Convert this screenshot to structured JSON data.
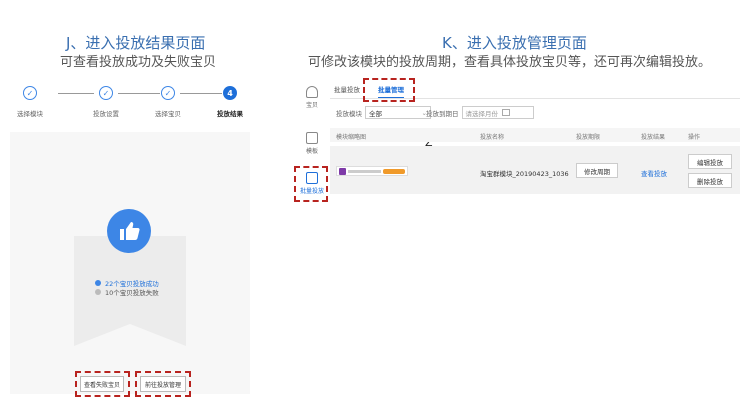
{
  "captions": {
    "left_title": "J、进入投放结果页面",
    "left_sub": "可查看投放成功及失败宝贝",
    "right_title": "K、进入投放管理页面",
    "right_sub": "可修改该模块的投放周期，查看具体投放宝贝等，还可再次编辑投放。"
  },
  "steps": [
    {
      "label": "选择模块",
      "icon": "✓"
    },
    {
      "label": "投放设置",
      "icon": "✓"
    },
    {
      "label": "选择宝贝",
      "icon": "✓"
    },
    {
      "label": "投放结果",
      "icon": "4"
    }
  ],
  "result": {
    "success_text": "22个宝贝投放成功",
    "fail_text": "10个宝贝投放失败"
  },
  "left_buttons": {
    "view_failed": "查看失败宝贝",
    "go_manage": "前往投放管理"
  },
  "sidebar": [
    {
      "label": "宝贝"
    },
    {
      "label": "模板"
    },
    {
      "label": "批量投放"
    }
  ],
  "tabs": [
    "批量投放",
    "批量管理"
  ],
  "filters": {
    "module_label": "投放模块",
    "module_value": "全部",
    "date_label": "投放到期日",
    "date_placeholder": "请选择月份"
  },
  "stray_char": "Z",
  "table": {
    "headers": [
      "模块缩略图",
      "投放名称",
      "投放期限",
      "投放结果",
      "操作"
    ],
    "row": {
      "name": "淘宝群模块_20190423_1036",
      "period_btn": "修改周期",
      "result_link": "查看投放",
      "edit_btn": "编辑投放",
      "delete_btn": "删除投放"
    }
  },
  "colors": {
    "accent": "#1e6fd9",
    "dash": "#b8231f"
  }
}
